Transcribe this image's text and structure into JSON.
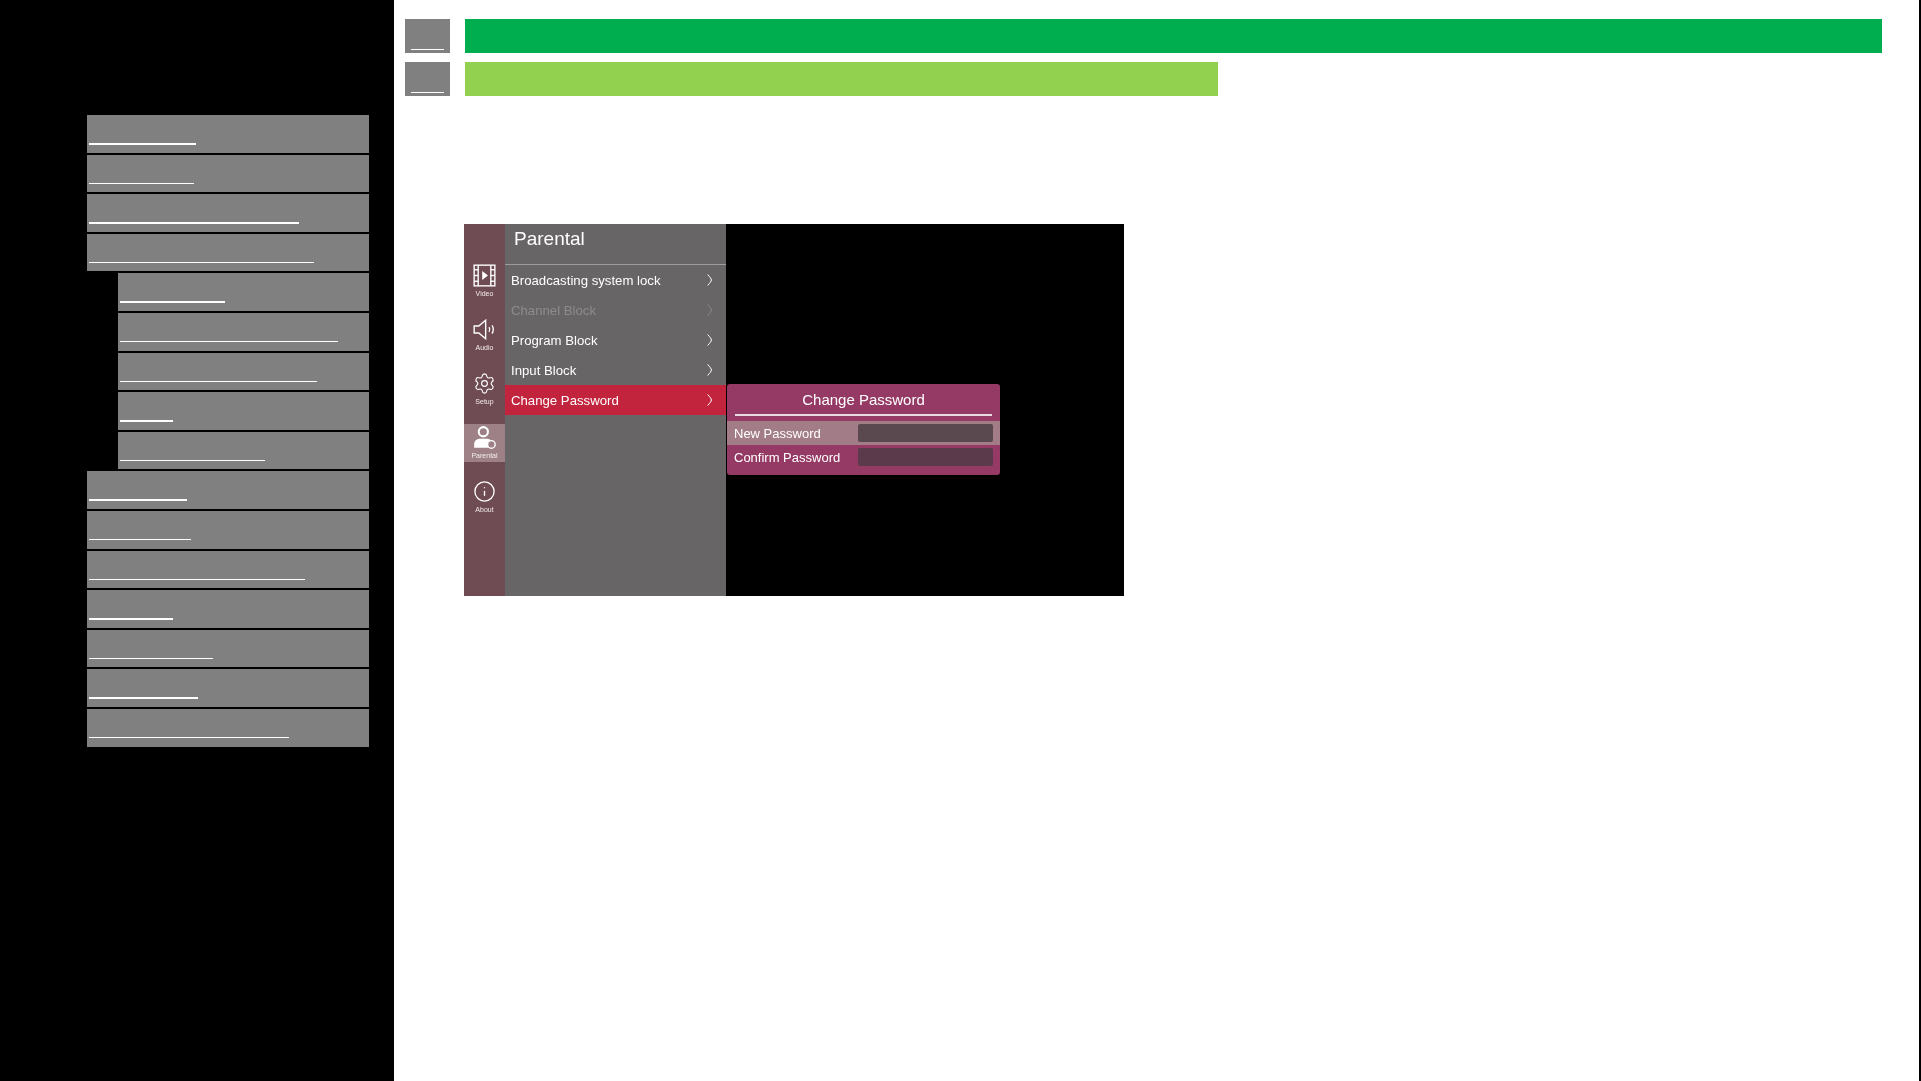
{
  "headings": [
    {
      "kind": "title",
      "color": "#00ae4f"
    },
    {
      "kind": "subtitle",
      "color": "#92d050"
    }
  ],
  "sidebar": {
    "items": [
      {
        "kind": "link"
      },
      {
        "kind": "link"
      },
      {
        "kind": "link"
      },
      {
        "kind": "link",
        "children": [
          {
            "kind": "link"
          },
          {
            "kind": "link"
          },
          {
            "kind": "link"
          },
          {
            "kind": "link"
          },
          {
            "kind": "link"
          }
        ]
      },
      {
        "kind": "link"
      },
      {
        "kind": "link"
      },
      {
        "kind": "link"
      },
      {
        "kind": "link"
      },
      {
        "kind": "link"
      },
      {
        "kind": "link"
      },
      {
        "kind": "link"
      }
    ]
  },
  "tv_menu": {
    "categories": [
      {
        "kind": "video",
        "label": "Video",
        "selected": false
      },
      {
        "kind": "audio",
        "label": "Audio",
        "selected": false
      },
      {
        "kind": "setup",
        "label": "Setup",
        "selected": false
      },
      {
        "kind": "parental",
        "label": "Parental",
        "selected": true
      },
      {
        "kind": "about",
        "label": "About",
        "selected": false
      }
    ],
    "title": "Parental",
    "items": [
      {
        "label": "Broadcasting system lock",
        "disabled": false,
        "selected": false
      },
      {
        "label": "Channel Block",
        "disabled": true,
        "selected": false
      },
      {
        "label": "Program Block",
        "disabled": false,
        "selected": false
      },
      {
        "label": "Input Block",
        "disabled": false,
        "selected": false
      },
      {
        "label": "Change Password",
        "disabled": false,
        "selected": true
      }
    ],
    "dialog": {
      "title": "Change Password",
      "fields": [
        {
          "label": "New Password",
          "selected": true
        },
        {
          "label": "Confirm Password",
          "selected": false
        }
      ]
    }
  }
}
